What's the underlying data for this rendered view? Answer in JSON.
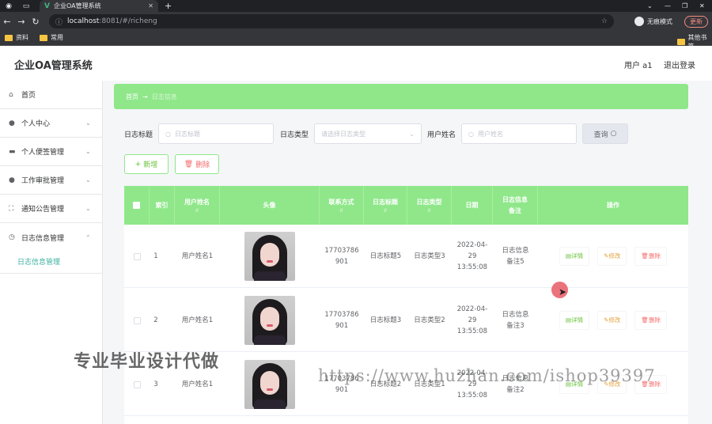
{
  "browser": {
    "tab_title": "企业OA管理系统",
    "url_host": "localhost",
    "url_path": ":8081/#/richeng",
    "profile_label": "无痕模式",
    "update_label": "更新",
    "bookmarks": [
      "资料",
      "常用"
    ],
    "bookmark_right": "其他书签"
  },
  "header": {
    "title": "企业OA管理系统",
    "user": "用户 a1",
    "logout": "退出登录"
  },
  "sidebar": {
    "items": [
      {
        "label": "首页",
        "icon": "home-icon"
      },
      {
        "label": "个人中心",
        "icon": "user-icon"
      },
      {
        "label": "个人便签管理",
        "icon": "note-icon"
      },
      {
        "label": "工作审批管理",
        "icon": "user-icon"
      },
      {
        "label": "通知公告管理",
        "icon": "fullscreen-icon"
      },
      {
        "label": "日志信息管理",
        "icon": "clock-icon"
      }
    ],
    "sub_item": "日志信息管理"
  },
  "breadcrumb": {
    "home": "首页",
    "current": "日志信息"
  },
  "search": {
    "label_title": "日志标题",
    "placeholder_title": "日志标题",
    "label_type": "日志类型",
    "placeholder_type": "请选择日志类型",
    "label_user": "用户姓名",
    "placeholder_user": "用户姓名",
    "query": "查询"
  },
  "actions": {
    "add": "新增",
    "delete": "删除"
  },
  "table": {
    "headers": [
      "索引",
      "用户姓名",
      "头像",
      "联系方式",
      "日志标题",
      "日志类型",
      "日期",
      "日志信息备注",
      "操作"
    ],
    "rows": [
      {
        "index": "1",
        "name": "用户姓名1",
        "phone": "17703786901",
        "title": "日志标题5",
        "type": "日志类型3",
        "date": "2022-04-29 13:55:08",
        "note": "日志信息备注5"
      },
      {
        "index": "2",
        "name": "用户姓名1",
        "phone": "17703786901",
        "title": "日志标题3",
        "type": "日志类型2",
        "date": "2022-04-29 13:55:08",
        "note": "日志信息备注3"
      },
      {
        "index": "3",
        "name": "用户姓名1",
        "phone": "17703786901",
        "title": "日志标题2",
        "type": "日志类型1",
        "date": "2022-04-29 13:55:08",
        "note": "日志信息备注2"
      }
    ],
    "op_detail": "详情",
    "op_edit": "修改",
    "op_delete": "删除"
  },
  "overlay": {
    "watermark_cn": "专业毕业设计代做",
    "watermark_url": "https://www.huzhan.com/ishop39397"
  }
}
